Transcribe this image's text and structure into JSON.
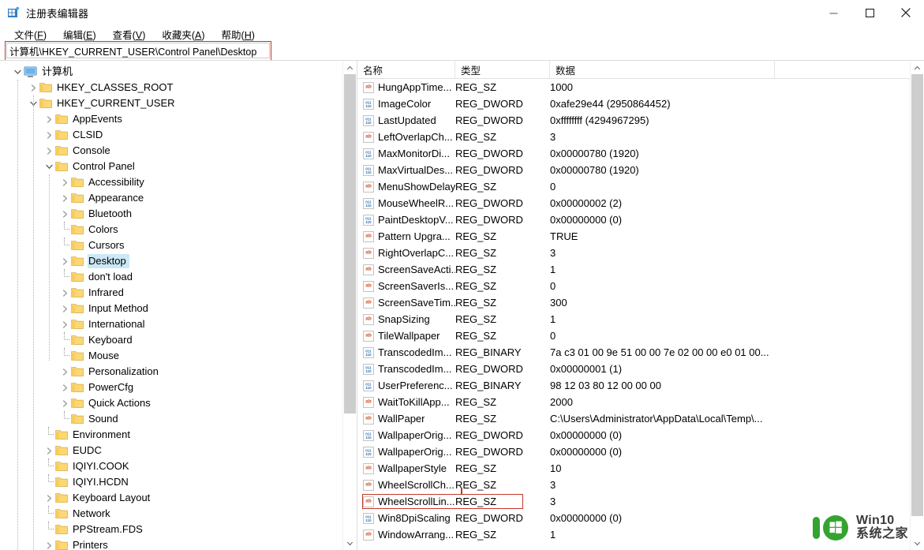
{
  "window": {
    "title": "注册表编辑器",
    "icon": "registry-editor-icon",
    "controls": {
      "minimize": "minimize-icon",
      "maximize": "maximize-icon",
      "close": "close-icon"
    }
  },
  "menubar": {
    "items": [
      {
        "label": "文件(F)",
        "text": "文件(",
        "accel": "F",
        "tail": ")"
      },
      {
        "label": "编辑(E)",
        "text": "编辑(",
        "accel": "E",
        "tail": ")"
      },
      {
        "label": "查看(V)",
        "text": "查看(",
        "accel": "V",
        "tail": ")"
      },
      {
        "label": "收藏夹(A)",
        "text": "收藏夹(",
        "accel": "A",
        "tail": ")"
      },
      {
        "label": "帮助(H)",
        "text": "帮助(",
        "accel": "H",
        "tail": ")"
      }
    ]
  },
  "address": {
    "value": "计算机\\HKEY_CURRENT_USER\\Control Panel\\Desktop",
    "annotation_color": "#c0392b"
  },
  "tree": {
    "root_label": "计算机",
    "items": [
      {
        "label": "计算机",
        "depth": 0,
        "expander": "expanded",
        "icon": "computer-icon",
        "selected": false
      },
      {
        "label": "HKEY_CLASSES_ROOT",
        "depth": 1,
        "expander": "collapsed",
        "icon": "folder-icon",
        "selected": false
      },
      {
        "label": "HKEY_CURRENT_USER",
        "depth": 1,
        "expander": "expanded",
        "icon": "folder-icon",
        "selected": false
      },
      {
        "label": "AppEvents",
        "depth": 2,
        "expander": "collapsed",
        "icon": "folder-icon",
        "selected": false
      },
      {
        "label": "CLSID",
        "depth": 2,
        "expander": "collapsed",
        "icon": "folder-icon",
        "selected": false
      },
      {
        "label": "Console",
        "depth": 2,
        "expander": "collapsed",
        "icon": "folder-icon",
        "selected": false
      },
      {
        "label": "Control Panel",
        "depth": 2,
        "expander": "expanded",
        "icon": "folder-icon",
        "selected": false
      },
      {
        "label": "Accessibility",
        "depth": 3,
        "expander": "collapsed",
        "icon": "folder-icon",
        "selected": false
      },
      {
        "label": "Appearance",
        "depth": 3,
        "expander": "collapsed",
        "icon": "folder-icon",
        "selected": false
      },
      {
        "label": "Bluetooth",
        "depth": 3,
        "expander": "collapsed",
        "icon": "folder-icon",
        "selected": false
      },
      {
        "label": "Colors",
        "depth": 3,
        "expander": "leaf",
        "icon": "folder-icon",
        "selected": false
      },
      {
        "label": "Cursors",
        "depth": 3,
        "expander": "leaf",
        "icon": "folder-icon",
        "selected": false
      },
      {
        "label": "Desktop",
        "depth": 3,
        "expander": "collapsed",
        "icon": "folder-icon",
        "selected": true
      },
      {
        "label": "don't load",
        "depth": 3,
        "expander": "leaf",
        "icon": "folder-icon",
        "selected": false
      },
      {
        "label": "Infrared",
        "depth": 3,
        "expander": "collapsed",
        "icon": "folder-icon",
        "selected": false
      },
      {
        "label": "Input Method",
        "depth": 3,
        "expander": "collapsed",
        "icon": "folder-icon",
        "selected": false
      },
      {
        "label": "International",
        "depth": 3,
        "expander": "collapsed",
        "icon": "folder-icon",
        "selected": false
      },
      {
        "label": "Keyboard",
        "depth": 3,
        "expander": "leaf",
        "icon": "folder-icon",
        "selected": false
      },
      {
        "label": "Mouse",
        "depth": 3,
        "expander": "leaf",
        "icon": "folder-icon",
        "selected": false
      },
      {
        "label": "Personalization",
        "depth": 3,
        "expander": "collapsed",
        "icon": "folder-icon",
        "selected": false
      },
      {
        "label": "PowerCfg",
        "depth": 3,
        "expander": "collapsed",
        "icon": "folder-icon",
        "selected": false
      },
      {
        "label": "Quick Actions",
        "depth": 3,
        "expander": "collapsed",
        "icon": "folder-icon",
        "selected": false
      },
      {
        "label": "Sound",
        "depth": 3,
        "expander": "leaf",
        "icon": "folder-icon",
        "selected": false
      },
      {
        "label": "Environment",
        "depth": 2,
        "expander": "leaf",
        "icon": "folder-icon",
        "selected": false
      },
      {
        "label": "EUDC",
        "depth": 2,
        "expander": "collapsed",
        "icon": "folder-icon",
        "selected": false
      },
      {
        "label": "IQIYI.COOK",
        "depth": 2,
        "expander": "leaf",
        "icon": "folder-icon",
        "selected": false
      },
      {
        "label": "IQIYI.HCDN",
        "depth": 2,
        "expander": "leaf",
        "icon": "folder-icon",
        "selected": false
      },
      {
        "label": "Keyboard Layout",
        "depth": 2,
        "expander": "collapsed",
        "icon": "folder-icon",
        "selected": false
      },
      {
        "label": "Network",
        "depth": 2,
        "expander": "leaf",
        "icon": "folder-icon",
        "selected": false
      },
      {
        "label": "PPStream.FDS",
        "depth": 2,
        "expander": "leaf",
        "icon": "folder-icon",
        "selected": false
      },
      {
        "label": "Printers",
        "depth": 2,
        "expander": "collapsed",
        "icon": "folder-icon",
        "selected": false
      }
    ]
  },
  "list": {
    "columns": [
      "名称",
      "类型",
      "数据"
    ],
    "rows": [
      {
        "name": "HungAppTime...",
        "type": "REG_SZ",
        "data": "1000",
        "icon": "string-value-icon",
        "highlighted": false
      },
      {
        "name": "ImageColor",
        "type": "REG_DWORD",
        "data": "0xafe29e44 (2950864452)",
        "icon": "binary-value-icon",
        "highlighted": false
      },
      {
        "name": "LastUpdated",
        "type": "REG_DWORD",
        "data": "0xffffffff (4294967295)",
        "icon": "binary-value-icon",
        "highlighted": false
      },
      {
        "name": "LeftOverlapCh...",
        "type": "REG_SZ",
        "data": "3",
        "icon": "string-value-icon",
        "highlighted": false
      },
      {
        "name": "MaxMonitorDi...",
        "type": "REG_DWORD",
        "data": "0x00000780 (1920)",
        "icon": "binary-value-icon",
        "highlighted": false
      },
      {
        "name": "MaxVirtualDes...",
        "type": "REG_DWORD",
        "data": "0x00000780 (1920)",
        "icon": "binary-value-icon",
        "highlighted": false
      },
      {
        "name": "MenuShowDelay",
        "type": "REG_SZ",
        "data": "0",
        "icon": "string-value-icon",
        "highlighted": false
      },
      {
        "name": "MouseWheelR...",
        "type": "REG_DWORD",
        "data": "0x00000002 (2)",
        "icon": "binary-value-icon",
        "highlighted": false
      },
      {
        "name": "PaintDesktopV...",
        "type": "REG_DWORD",
        "data": "0x00000000 (0)",
        "icon": "binary-value-icon",
        "highlighted": false
      },
      {
        "name": "Pattern Upgra...",
        "type": "REG_SZ",
        "data": "TRUE",
        "icon": "string-value-icon",
        "highlighted": false
      },
      {
        "name": "RightOverlapC...",
        "type": "REG_SZ",
        "data": "3",
        "icon": "string-value-icon",
        "highlighted": false
      },
      {
        "name": "ScreenSaveActi...",
        "type": "REG_SZ",
        "data": "1",
        "icon": "string-value-icon",
        "highlighted": false
      },
      {
        "name": "ScreenSaverIs...",
        "type": "REG_SZ",
        "data": "0",
        "icon": "string-value-icon",
        "highlighted": false
      },
      {
        "name": "ScreenSaveTim...",
        "type": "REG_SZ",
        "data": "300",
        "icon": "string-value-icon",
        "highlighted": false
      },
      {
        "name": "SnapSizing",
        "type": "REG_SZ",
        "data": "1",
        "icon": "string-value-icon",
        "highlighted": false
      },
      {
        "name": "TileWallpaper",
        "type": "REG_SZ",
        "data": "0",
        "icon": "string-value-icon",
        "highlighted": false
      },
      {
        "name": "TranscodedIm...",
        "type": "REG_BINARY",
        "data": "7a c3 01 00 9e 51 00 00 7e 02 00 00 e0 01 00...",
        "icon": "binary-value-icon",
        "highlighted": false
      },
      {
        "name": "TranscodedIm...",
        "type": "REG_DWORD",
        "data": "0x00000001 (1)",
        "icon": "binary-value-icon",
        "highlighted": false
      },
      {
        "name": "UserPreferenc...",
        "type": "REG_BINARY",
        "data": "98 12 03 80 12 00 00 00",
        "icon": "binary-value-icon",
        "highlighted": false
      },
      {
        "name": "WaitToKillApp...",
        "type": "REG_SZ",
        "data": "2000",
        "icon": "string-value-icon",
        "highlighted": false
      },
      {
        "name": "WallPaper",
        "type": "REG_SZ",
        "data": "C:\\Users\\Administrator\\AppData\\Local\\Temp\\...",
        "icon": "string-value-icon",
        "highlighted": false
      },
      {
        "name": "WallpaperOrig...",
        "type": "REG_DWORD",
        "data": "0x00000000 (0)",
        "icon": "binary-value-icon",
        "highlighted": false
      },
      {
        "name": "WallpaperOrig...",
        "type": "REG_DWORD",
        "data": "0x00000000 (0)",
        "icon": "binary-value-icon",
        "highlighted": false
      },
      {
        "name": "WallpaperStyle",
        "type": "REG_SZ",
        "data": "10",
        "icon": "string-value-icon",
        "highlighted": false
      },
      {
        "name": "WheelScrollCh...",
        "type": "REG_SZ",
        "data": "3",
        "icon": "string-value-icon",
        "highlighted": false
      },
      {
        "name": "WheelScrollLin...",
        "type": "REG_SZ",
        "data": "3",
        "icon": "string-value-icon",
        "highlighted": true
      },
      {
        "name": "Win8DpiScaling",
        "type": "REG_DWORD",
        "data": "0x00000000 (0)",
        "icon": "binary-value-icon",
        "highlighted": false
      },
      {
        "name": "WindowArrang...",
        "type": "REG_SZ",
        "data": "1",
        "icon": "string-value-icon",
        "highlighted": false
      }
    ]
  },
  "watermark": {
    "brand_en": "Win10",
    "brand_cn": "系统之家",
    "logo_color": "#35a32f"
  }
}
